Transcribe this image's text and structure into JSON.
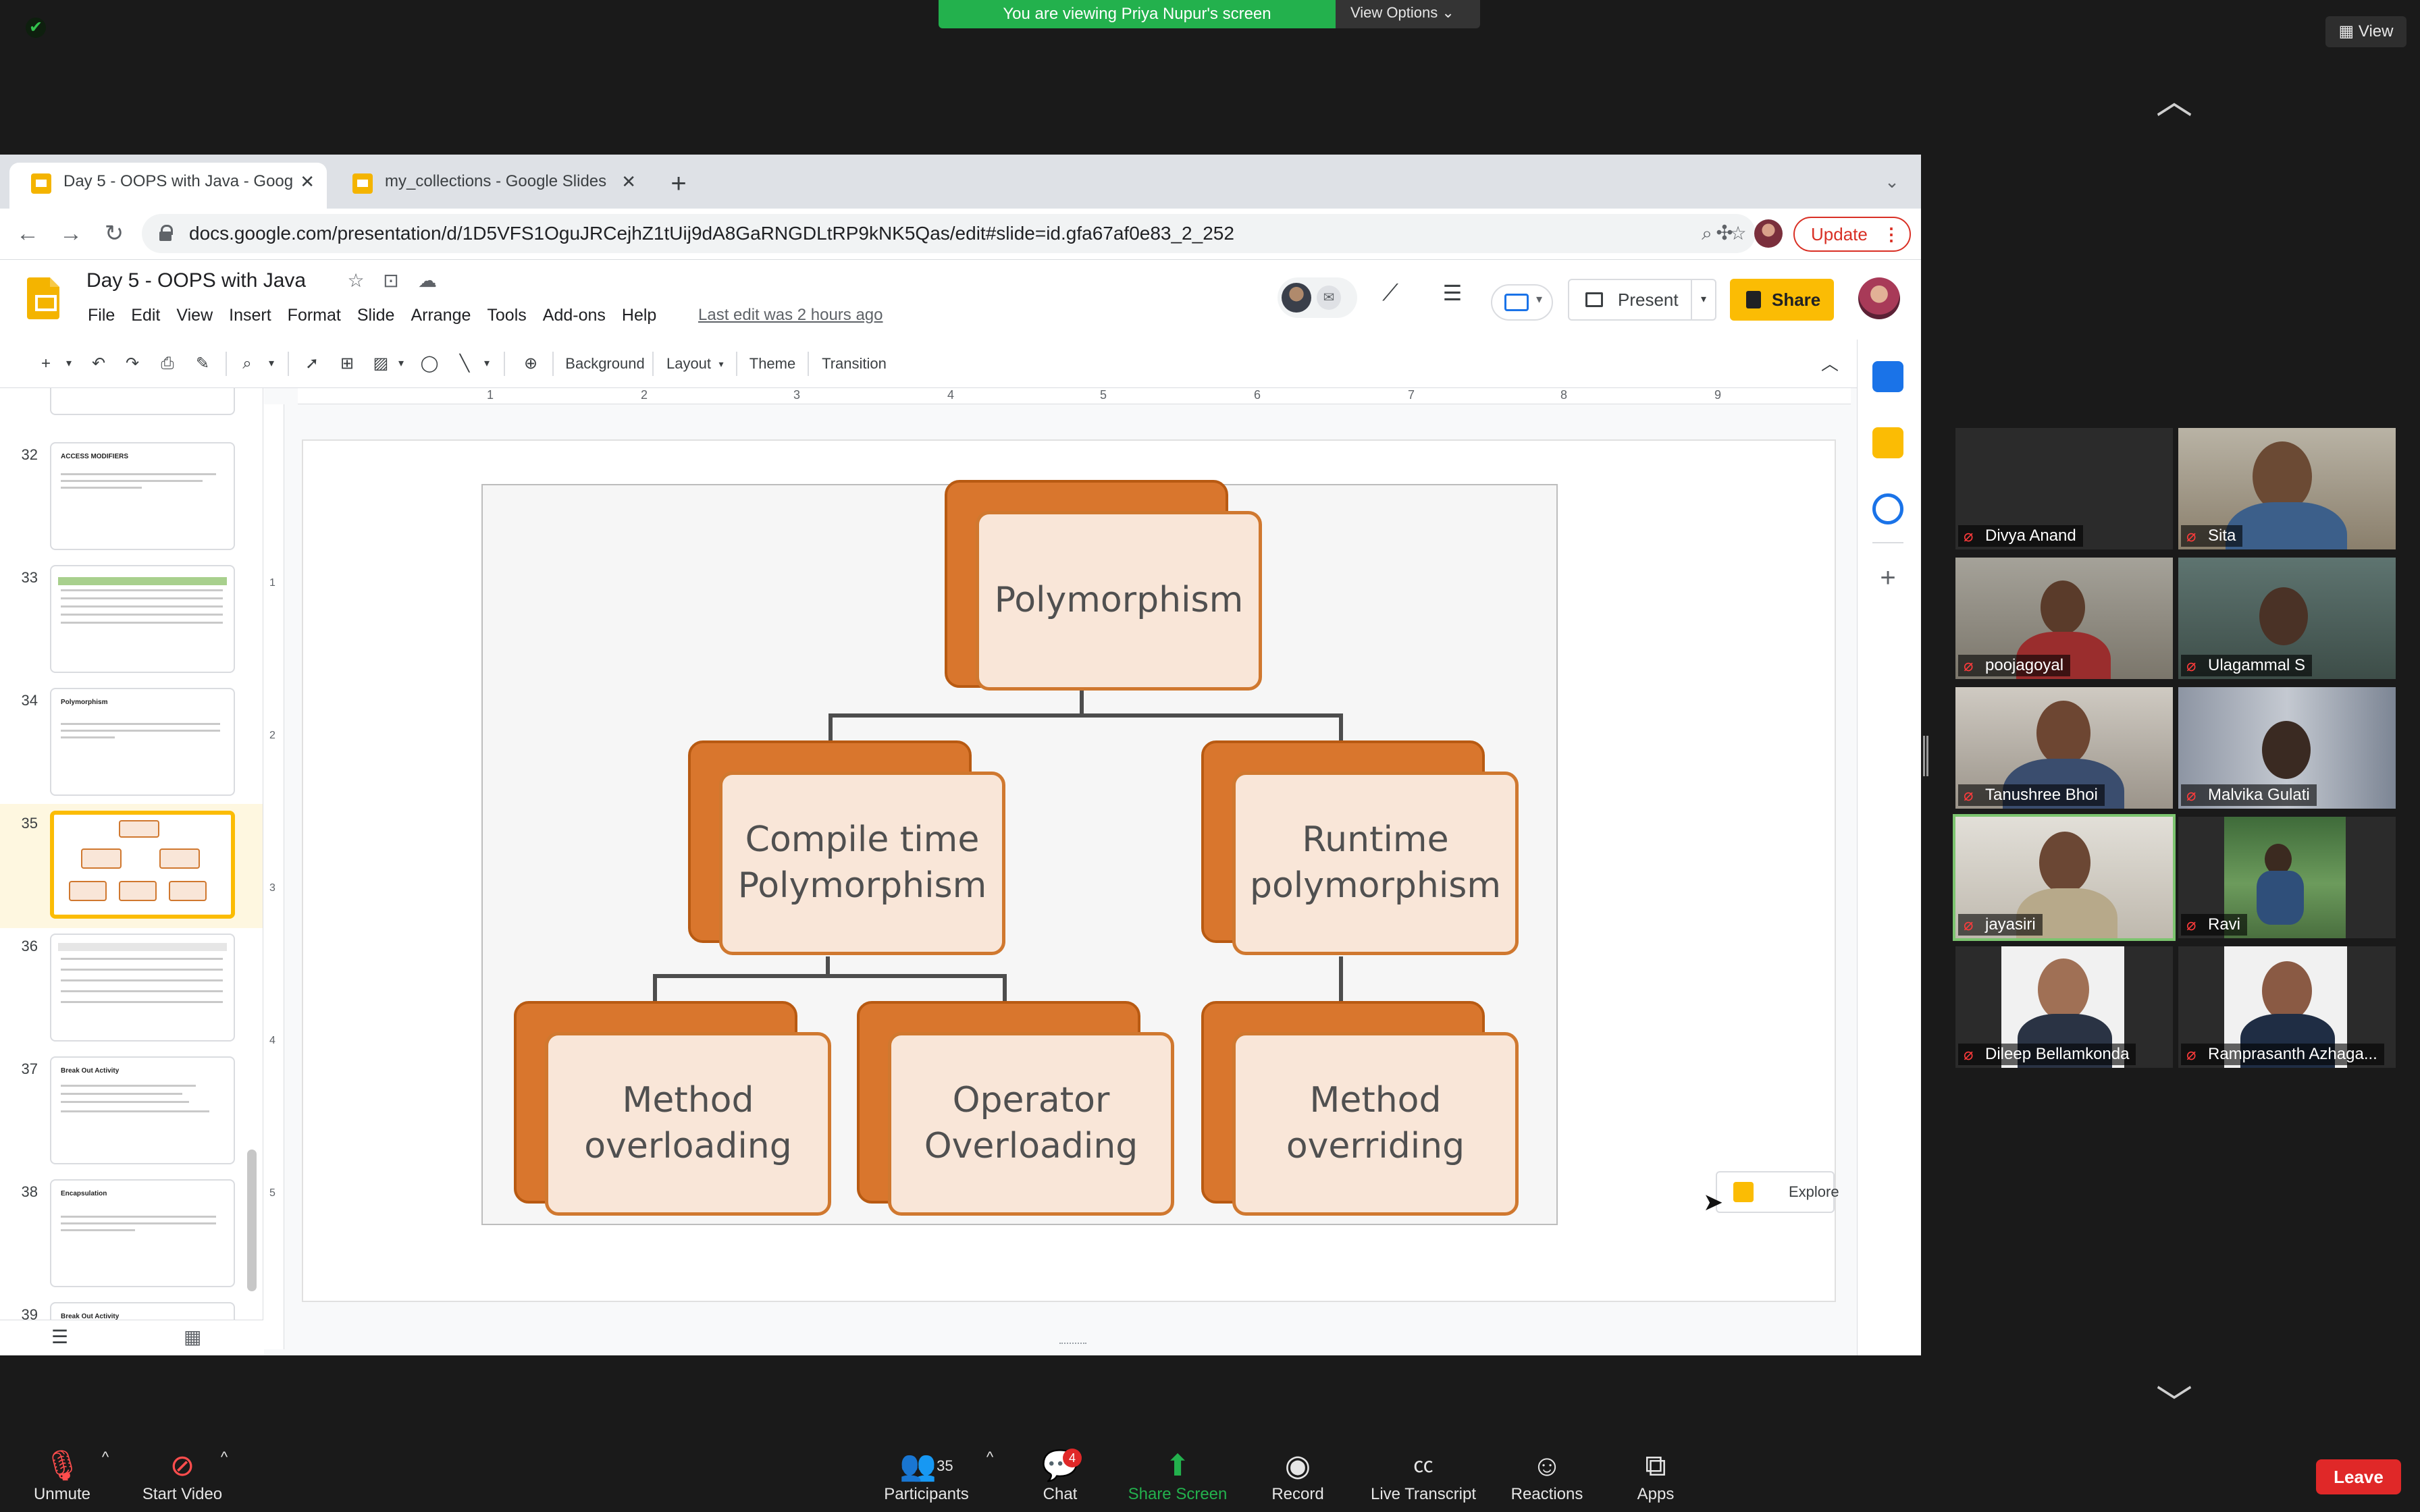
{
  "zoom": {
    "share_banner": "You are viewing Priya Nupur's screen",
    "view_options": "View Options ⌄",
    "view_button": "View",
    "participants": [
      {
        "name": "Divya Anand"
      },
      {
        "name": "Sita"
      },
      {
        "name": "poojagoyal"
      },
      {
        "name": "Ulagammal  S"
      },
      {
        "name": "Tanushree Bhoi"
      },
      {
        "name": "Malvika Gulati"
      },
      {
        "name": "jayasiri"
      },
      {
        "name": "Ravi"
      },
      {
        "name": "Dileep Bellamkonda"
      },
      {
        "name": "Ramprasanth Azhaga..."
      }
    ],
    "toolbar": {
      "unmute": "Unmute",
      "start_video": "Start Video",
      "participants": "Participants",
      "participants_count": "35",
      "chat": "Chat",
      "chat_badge": "4",
      "share_screen": "Share Screen",
      "record": "Record",
      "live_transcript": "Live Transcript",
      "reactions": "Reactions",
      "apps": "Apps",
      "leave": "Leave"
    },
    "colors": {
      "share_green": "#23b14d",
      "leave_red": "#e02828"
    }
  },
  "browser": {
    "tabs": [
      {
        "title": "Day 5 - OOPS with Java - Goog",
        "active": true
      },
      {
        "title": "my_collections - Google Slides",
        "active": false
      }
    ],
    "url": "docs.google.com/presentation/d/1D5VFS1OguJRCejhZ1tUij9dA8GaRNGDLtRP9kNK5Qas/edit#slide=id.gfa67af0e83_2_252",
    "update_label": "Update"
  },
  "slides": {
    "title": "Day 5 - OOPS with Java",
    "menu": [
      "File",
      "Edit",
      "View",
      "Insert",
      "Format",
      "Slide",
      "Arrange",
      "Tools",
      "Add-ons",
      "Help"
    ],
    "last_edit": "Last edit was 2 hours ago",
    "present": "Present",
    "share": "Share",
    "toolbar": {
      "background": "Background",
      "layout": "Layout",
      "theme": "Theme",
      "transition": "Transition"
    },
    "explore": "Explore",
    "ruler_h": [
      "1",
      "2",
      "3",
      "4",
      "5",
      "6",
      "7",
      "8",
      "9"
    ],
    "ruler_v": [
      "1",
      "2",
      "3",
      "4",
      "5"
    ],
    "thumbnails": [
      {
        "num": "32",
        "title": "ACCESS MODIFIERS"
      },
      {
        "num": "33",
        "title": ""
      },
      {
        "num": "34",
        "title": "Polymorphism"
      },
      {
        "num": "35",
        "title": "",
        "selected": true
      },
      {
        "num": "36",
        "title": ""
      },
      {
        "num": "37",
        "title": "Break Out Activity"
      },
      {
        "num": "38",
        "title": "Encapsulation"
      },
      {
        "num": "39",
        "title": "Break Out Activity"
      }
    ],
    "diagram": {
      "root": "Polymorphism",
      "left": "Compile time\nPolymorphism",
      "right": "Runtime\npolymorphism",
      "leaf1": "Method\noverloading",
      "leaf2": "Operator\nOverloading",
      "leaf3": "Method\noverriding"
    }
  }
}
